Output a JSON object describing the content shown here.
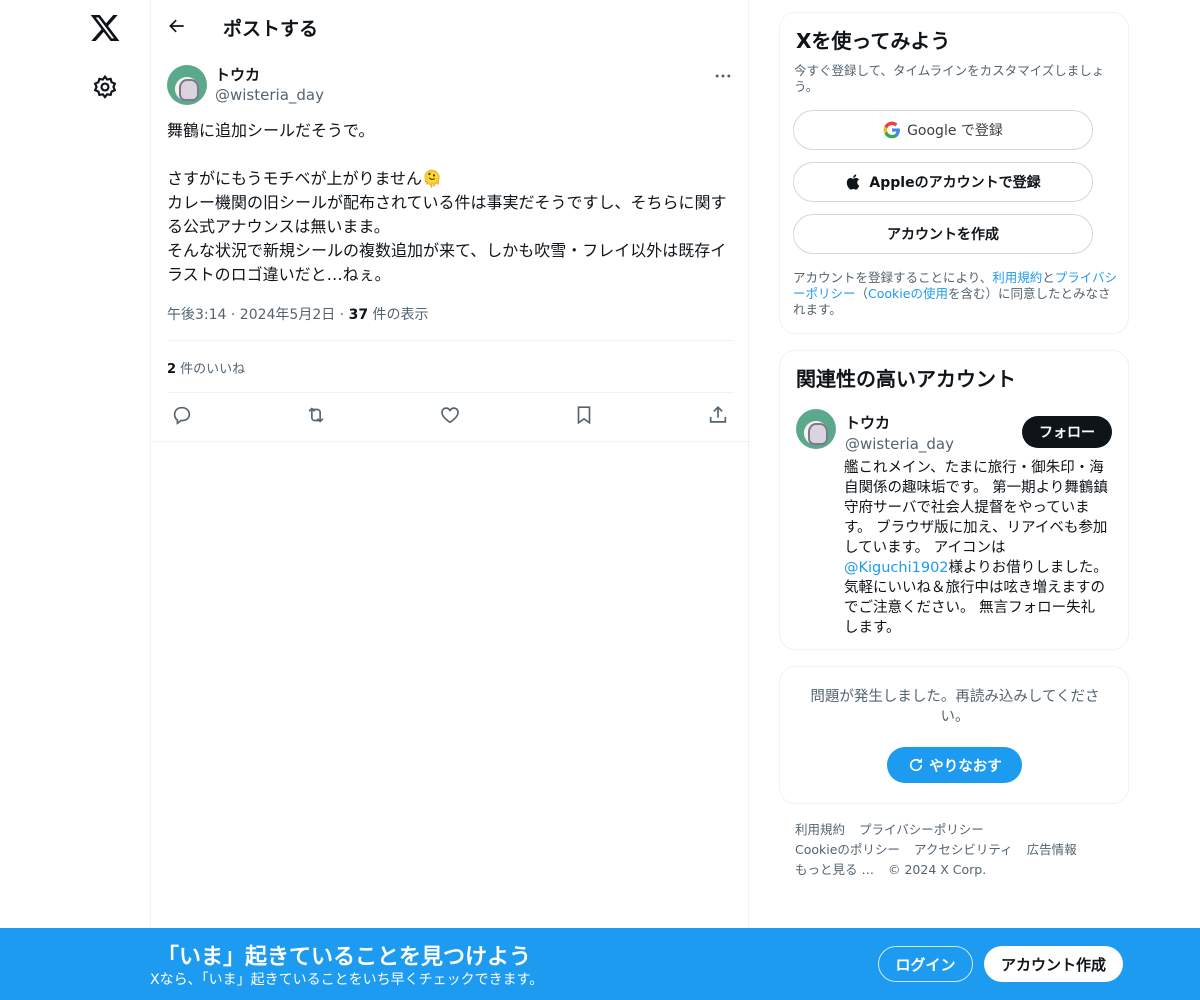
{
  "header": {
    "title": "ポストする"
  },
  "post": {
    "author_name": "トウカ",
    "author_handle": "@wisteria_day",
    "text": "舞鶴に追加シールだそうで。\n\nさすがにもうモチベが上がりません🫠\nカレー機関の旧シールが配布されている件は事実だそうですし、そちらに関する公式アナウンスは無いまま。\nそんな状況で新規シールの複数追加が来て、しかも吹雪・フレイ以外は既存イラストのロゴ違いだと…ねぇ。",
    "time": "午後3:14 · 2024年5月2日 · ",
    "views_count": "37",
    "views_label": " 件の表示",
    "likes_count": "2",
    "likes_label": " 件のいいね"
  },
  "signup_card": {
    "title": "Xを使ってみよう",
    "subtitle": "今すぐ登録して、タイムラインをカスタマイズしましょう。",
    "google_label": "Google で登録",
    "apple_label": "Appleのアカウントで登録",
    "create_label": "アカウントを作成",
    "legal_prefix": "アカウントを登録することにより、",
    "legal_terms": "利用規約",
    "legal_and": "と",
    "legal_privacy": "プライバシーポリシー",
    "legal_open": "（",
    "legal_cookie": "Cookieの使用",
    "legal_suffix": "を含む）に同意したとみなされます。"
  },
  "related": {
    "title": "関連性の高いアカウント",
    "name": "トウカ",
    "handle": "@wisteria_day",
    "follow_label": "フォロー",
    "bio_part1": "艦これメイン、たまに旅行・御朱印・海自関係の趣味垢です。 第一期より舞鶴鎮守府サーバで社会人提督をやっています。 ブラウザ版に加え、リアイベも参加しています。 アイコンは",
    "bio_mention": "@Kiguchi1902",
    "bio_part2": "様よりお借りしました。 気軽にいいね＆旅行中は呟き増えますのでご注意ください。 無言フォロー失礼します。"
  },
  "error_card": {
    "message": "問題が発生しました。再読み込みしてください。",
    "retry_label": "やりなおす"
  },
  "footer": {
    "links": [
      "利用規約",
      "プライバシーポリシー",
      "Cookieのポリシー",
      "アクセシビリティ",
      "広告情報",
      "もっと見る …",
      "© 2024 X Corp."
    ]
  },
  "banner": {
    "title": "「いま」起きていることを見つけよう",
    "subtitle": "Xなら、「いま」起きていることをいち早くチェックできます。",
    "login_label": "ログイン",
    "signup_label": "アカウント作成"
  },
  "colors": {
    "accent": "#1d9bf0",
    "text": "#0f1419",
    "muted": "#536471",
    "border": "#eff3f4"
  },
  "icons": [
    "x-logo-icon",
    "gear-icon",
    "back-arrow-icon",
    "more-icon",
    "reply-icon",
    "retweet-icon",
    "like-icon",
    "bookmark-icon",
    "share-icon",
    "google-icon",
    "apple-icon",
    "refresh-icon"
  ]
}
